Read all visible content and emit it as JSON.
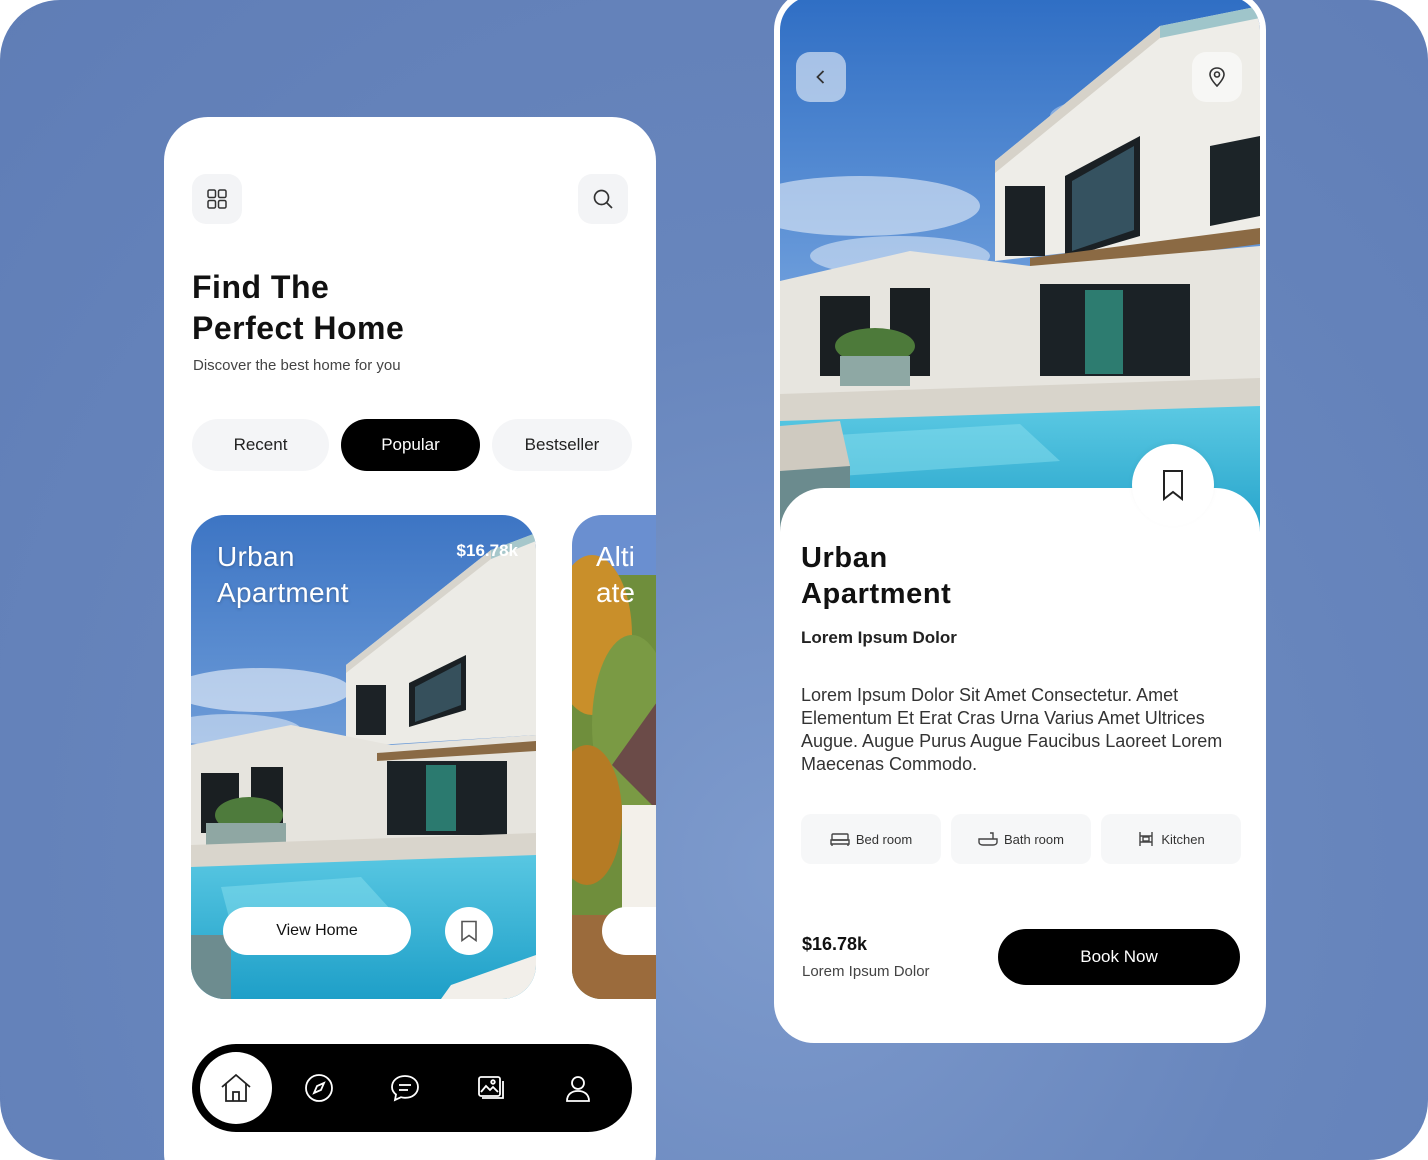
{
  "home_screen": {
    "headline_line1": "Find The",
    "headline_line2": "Perfect Home",
    "subtitle": "Discover the best home for you",
    "filters": [
      {
        "label": "Recent",
        "active": false
      },
      {
        "label": "Popular",
        "active": true
      },
      {
        "label": "Bestseller",
        "active": false
      }
    ],
    "cards": [
      {
        "title_line1": "Urban",
        "title_line2": "Apartment",
        "price": "$16.78k",
        "button": "View Home"
      },
      {
        "title_line1": "Alti",
        "title_line2": "ate"
      }
    ],
    "nav_items": [
      "home-icon",
      "compass-icon",
      "chat-icon",
      "gallery-icon",
      "profile-icon"
    ]
  },
  "detail_screen": {
    "title_line1": "Urban",
    "title_line2": "Apartment",
    "subtitle": "Lorem Ipsum Dolor",
    "description": "Lorem Ipsum Dolor Sit Amet Consectetur. Amet Elementum Et Erat Cras Urna Varius Amet Ultrices Augue. Augue Purus Augue Faucibus Laoreet Lorem Maecenas Commodo.",
    "features": [
      {
        "label": "Bed room",
        "icon": "bed-icon"
      },
      {
        "label": "Bath room",
        "icon": "bathtub-icon"
      },
      {
        "label": "Kitchen",
        "icon": "kitchen-icon"
      }
    ],
    "price": "$16.78k",
    "price_caption": "Lorem Ipsum Dolor",
    "cta": "Book Now"
  },
  "colors": {
    "background": "#6886bd",
    "primary": "#000000",
    "surface": "#ffffff",
    "chip": "#f4f5f7"
  }
}
